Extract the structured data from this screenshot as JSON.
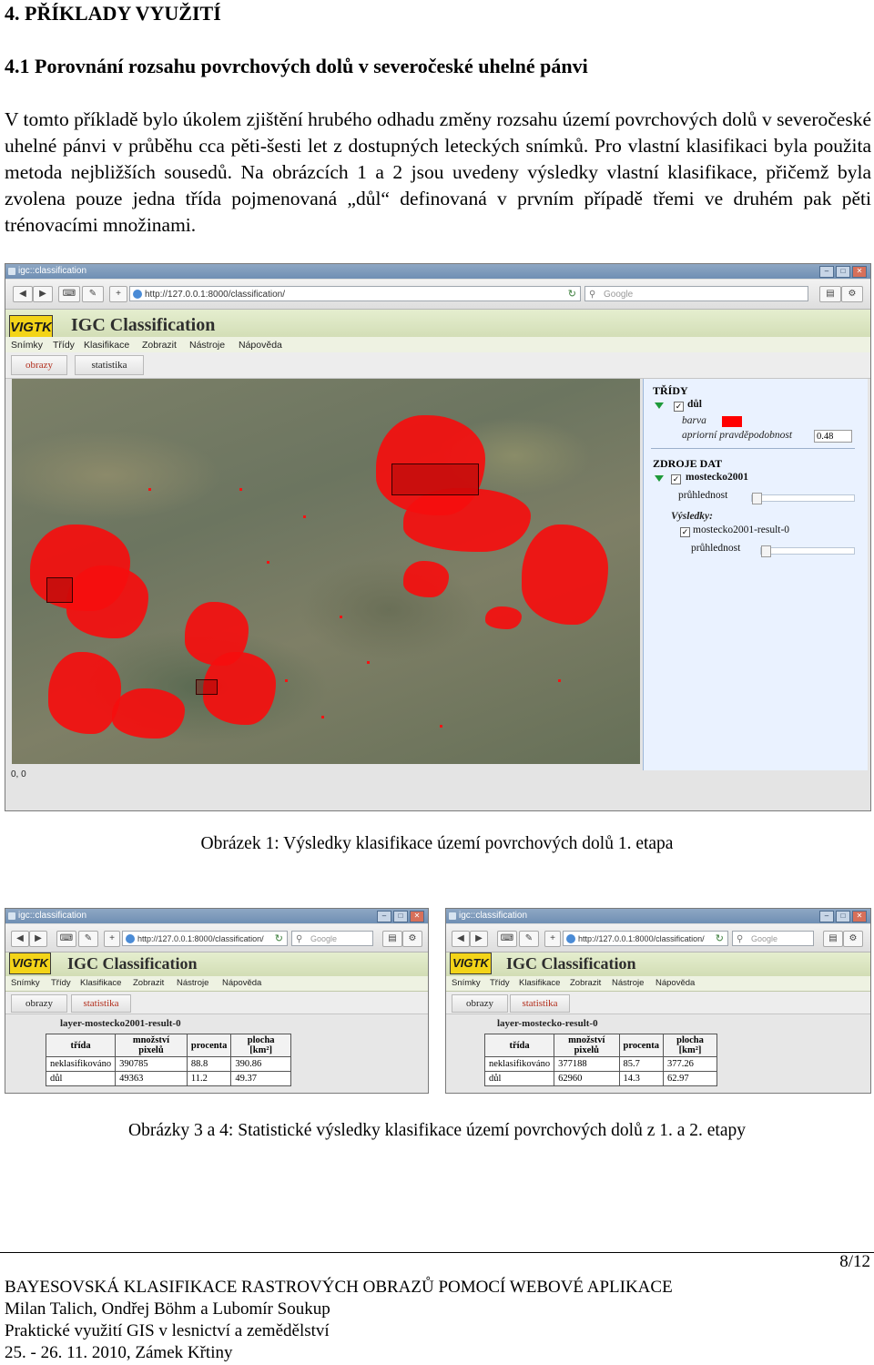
{
  "heading1": "4.   PŘÍKLADY VYUŽITÍ",
  "heading2": "4.1  Porovnání rozsahu povrchových dolů v severočeské uhelné pánvi",
  "paragraph": "V tomto příkladě bylo úkolem zjištění hrubého odhadu změny rozsahu území povrchových dolů v severočeské uhelné pánvi v průběhu cca pěti-šesti let z dostupných leteckých snímků. Pro vlastní klasifikaci byla použita metoda nejbližších sousedů. Na obrázcích 1 a 2 jsou uvedeny výsledky vlastní klasifikace, přičemž byla zvolena pouze jedna třída pojmenovaná „důl“ definovaná v prvním případě třemi ve druhém pak pěti trénovacími množinami.",
  "browser": {
    "window_title": "igc::classification",
    "url": "http://127.0.0.1:8000/classification/",
    "search_placeholder": "Google",
    "logo_text": "VIGTK",
    "app_title": "IGC Classification",
    "menu": [
      "Snímky",
      "Třídy",
      "Klasifikace",
      "Zobrazit",
      "Nástroje",
      "Nápověda"
    ],
    "tabs": [
      "obrazy",
      "statistika"
    ]
  },
  "panel": {
    "classes_header": "TŘÍDY",
    "class_name": "důl",
    "color_label": "barva",
    "color_value": "#ff0000",
    "prior_label": "apriorní pravděpodobnost",
    "prior_value": "0.48",
    "data_header": "ZDROJE DAT",
    "data_name": "mostecko2001",
    "opacity_label": "průhlednost",
    "results_label": "Výsledky:",
    "result_name": "mostecko2001-result-0",
    "opacity_label2": "průhlednost"
  },
  "map_coords": "0, 0",
  "caption1": "Obrázek 1: Výsledky klasifikace území povrchových dolů 1. etapa",
  "stats": [
    {
      "layer_title": "layer-mostecko2001-result-0",
      "headers": [
        "třída",
        "množství pixelů",
        "procenta",
        "plocha [km²]"
      ],
      "rows": [
        [
          "neklasifikováno",
          "390785",
          "88.8",
          "390.86"
        ],
        [
          "důl",
          "49363",
          "11.2",
          "49.37"
        ]
      ]
    },
    {
      "layer_title": "layer-mostecko-result-0",
      "headers": [
        "třída",
        "množství pixelů",
        "procenta",
        "plocha [km²]"
      ],
      "rows": [
        [
          "neklasifikováno",
          "377188",
          "85.7",
          "377.26"
        ],
        [
          "důl",
          "62960",
          "14.3",
          "62.97"
        ]
      ]
    }
  ],
  "caption2": "Obrázky 3 a 4: Statistické výsledky klasifikace území povrchových dolů z 1. a 2. etapy",
  "footer": {
    "page": "8/12",
    "title": "BAYESOVSKÁ KLASIFIKACE RASTROVÝCH OBRAZŮ POMOCÍ WEBOVÉ APLIKACE",
    "authors": "Milan Talich, Ondřej Böhm a Lubomír Soukup",
    "conference": "Praktické využití GIS v lesnictví a zemědělství",
    "date_place": "25. - 26. 11. 2010, Zámek Křtiny"
  }
}
